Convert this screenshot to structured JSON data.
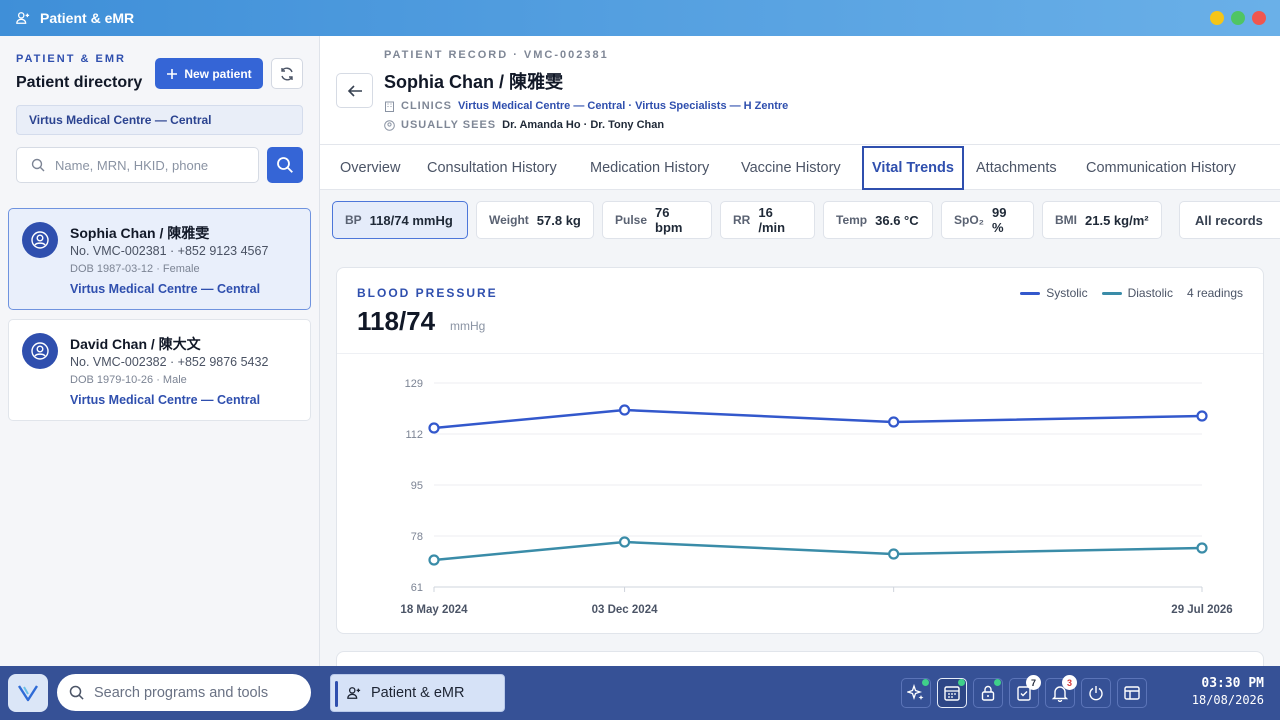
{
  "window": {
    "title": "Patient & eMR"
  },
  "sidebar": {
    "kicker": "PATIENT & EMR",
    "title": "Patient directory",
    "new_patient_label": "New patient",
    "clinic_selected": "Virtus Medical Centre — Central",
    "search_placeholder": "Name, MRN, HKID, phone",
    "patients": [
      {
        "name": "Sophia Chan / 陳雅雯",
        "meta": "No. VMC-002381 · +852 9123 4567",
        "dob": "DOB 1987-03-12 · Female",
        "clinic": "Virtus Medical Centre — Central",
        "selected": true
      },
      {
        "name": "David Chan / 陳大文",
        "meta": "No. VMC-002382 · +852 9876 5432",
        "dob": "DOB 1979-10-26 · Male",
        "clinic": "Virtus Medical Centre — Central",
        "selected": false
      }
    ]
  },
  "record": {
    "label": "PATIENT RECORD · VMC-002381",
    "name": "Sophia Chan / 陳雅雯",
    "clinics_label": "CLINICS",
    "clinics_value": "Virtus Medical Centre — Central · Virtus Specialists — H Zentre",
    "sees_label": "USUALLY SEES",
    "sees_value": "Dr. Amanda Ho · Dr. Tony Chan"
  },
  "tabs": [
    {
      "label": "Overview",
      "active": false
    },
    {
      "label": "Consultation History",
      "active": false
    },
    {
      "label": "Medication History",
      "active": false
    },
    {
      "label": "Vaccine History",
      "active": false
    },
    {
      "label": "Vital Trends",
      "active": true
    },
    {
      "label": "Attachments",
      "active": false
    },
    {
      "label": "Communication History",
      "active": false
    }
  ],
  "vitals": [
    {
      "label": "BP",
      "value": "118/74 mmHg",
      "active": true
    },
    {
      "label": "Weight",
      "value": "57.8 kg",
      "active": false
    },
    {
      "label": "Pulse",
      "value": "76 bpm",
      "active": false
    },
    {
      "label": "RR",
      "value": "16 /min",
      "active": false
    },
    {
      "label": "Temp",
      "value": "36.6 °C",
      "active": false
    },
    {
      "label": "SpO₂",
      "value": "99 %",
      "active": false
    },
    {
      "label": "BMI",
      "value": "21.5 kg/m²",
      "active": false
    }
  ],
  "range_select": "All records",
  "bp_card": {
    "title": "BLOOD PRESSURE",
    "value": "118/74",
    "unit": "mmHg",
    "readings": "4 readings"
  },
  "chart_data": {
    "type": "line",
    "title": "BLOOD PRESSURE",
    "x": [
      "2024-05-18",
      "2024-12-03",
      "2025-09-10",
      "2026-07-29"
    ],
    "x_tick_labels": [
      "18 May 2024",
      "03 Dec 2024",
      "",
      "29 Jul 2026"
    ],
    "yticks": [
      61,
      78,
      95,
      112,
      129
    ],
    "ylim": [
      61,
      129
    ],
    "series": [
      {
        "name": "Systolic",
        "values": [
          114,
          120,
          116,
          118
        ],
        "color": "#3358cc"
      },
      {
        "name": "Diastolic",
        "values": [
          70,
          76,
          72,
          74
        ],
        "color": "#3a8ca8"
      }
    ],
    "grid": true,
    "legend": "top-right"
  },
  "taskbar": {
    "search_placeholder": "Search programs and tools",
    "app_label": "Patient & eMR",
    "tasks_badge": "7",
    "alerts_badge": "3",
    "time": "03:30 PM",
    "date": "18/08/2026"
  },
  "colors": {
    "accent": "#2f4fae",
    "primary_button": "#3565d6",
    "titlebar": "#4c9be0",
    "taskbar": "#365196"
  }
}
